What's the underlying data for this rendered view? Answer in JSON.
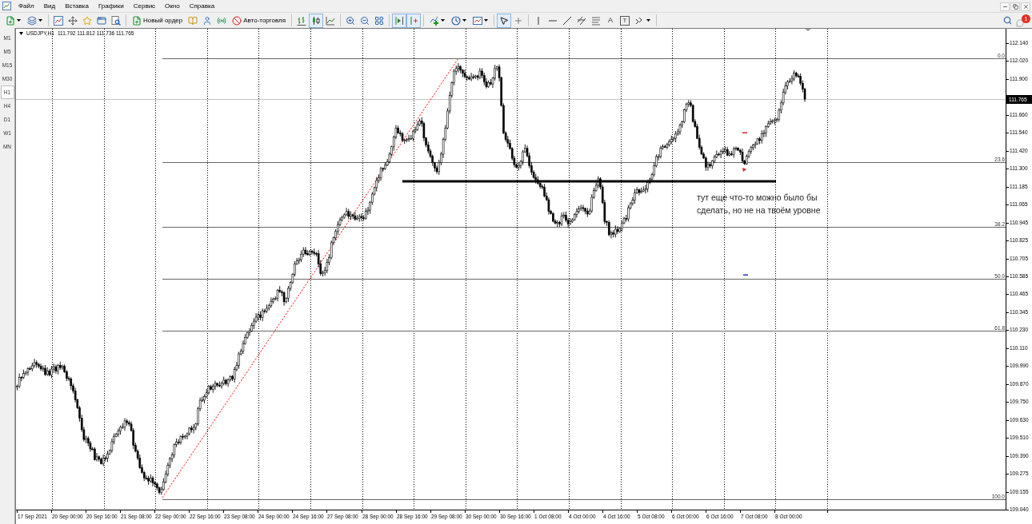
{
  "menu_bar": {
    "items": [
      "Файл",
      "Вид",
      "Вставка",
      "Графики",
      "Сервис",
      "Окно",
      "Справка"
    ]
  },
  "toolbar": {
    "new_order": "Новый ордер",
    "auto_trading": "Авто-торговля",
    "chart_types": [
      {
        "selected": false
      },
      {
        "selected": true
      },
      {
        "selected": false
      }
    ],
    "chart_shift": {
      "selected": true
    },
    "autoscroll": {
      "selected": true
    },
    "cursor_modes": [
      {
        "selected": true
      },
      {
        "selected": false
      }
    ],
    "text_tool": "A",
    "text_label_tool": "T",
    "notifications_badge": "1"
  },
  "timeframes": [
    {
      "label": "M1",
      "selected": false
    },
    {
      "label": "M5",
      "selected": false
    },
    {
      "label": "M15",
      "selected": false
    },
    {
      "label": "M30",
      "selected": false
    },
    {
      "label": "H1",
      "selected": true
    },
    {
      "label": "H4",
      "selected": false
    },
    {
      "label": "D1",
      "selected": false
    },
    {
      "label": "W1",
      "selected": false
    },
    {
      "label": "MN",
      "selected": false
    }
  ],
  "chart": {
    "symbol": "USDJPY,H1",
    "ohlc": [
      "111.792",
      "111.812",
      "111.736",
      "111.765"
    ],
    "price_axis": {
      "labels": [
        "112.140",
        "112.020",
        "111.900",
        "111.660",
        "111.540",
        "111.420",
        "111.300",
        "111.185",
        "111.065",
        "110.945",
        "110.825",
        "110.705",
        "110.585",
        "110.465",
        "110.345",
        "110.230",
        "110.110",
        "109.990",
        "109.870",
        "109.750",
        "109.630",
        "109.510",
        "109.390",
        "109.275",
        "109.155",
        "109.040"
      ],
      "current_price": "111.765"
    },
    "time_axis": {
      "labels": [
        "17 Sep 2021",
        "20 Sep 00:00",
        "20 Sep 16:00",
        "21 Sep 08:00",
        "22 Sep 00:00",
        "22 Sep 16:00",
        "23 Sep 08:00",
        "24 Sep 00:00",
        "24 Sep 16:00",
        "27 Sep 08:00",
        "28 Sep 00:00",
        "28 Sep 16:00",
        "29 Sep 08:00",
        "30 Sep 00:00",
        "30 Sep 16:00",
        "1 Oct 08:00",
        "4 Oct 00:00",
        "4 Oct 16:00",
        "5 Oct 08:00",
        "6 Oct 00:00",
        "6 Oct 16:00",
        "7 Oct 08:00",
        "8 Oct 00:00"
      ]
    },
    "fibonacci_levels": [
      {
        "label": "0.0"
      },
      {
        "label": "23.6"
      },
      {
        "label": "38.2"
      },
      {
        "label": "50.0"
      },
      {
        "label": "61.8"
      },
      {
        "label": "100.0"
      }
    ],
    "annotation": "тут еще что-то можно было бы сделать, но не на твоём уровне"
  }
}
